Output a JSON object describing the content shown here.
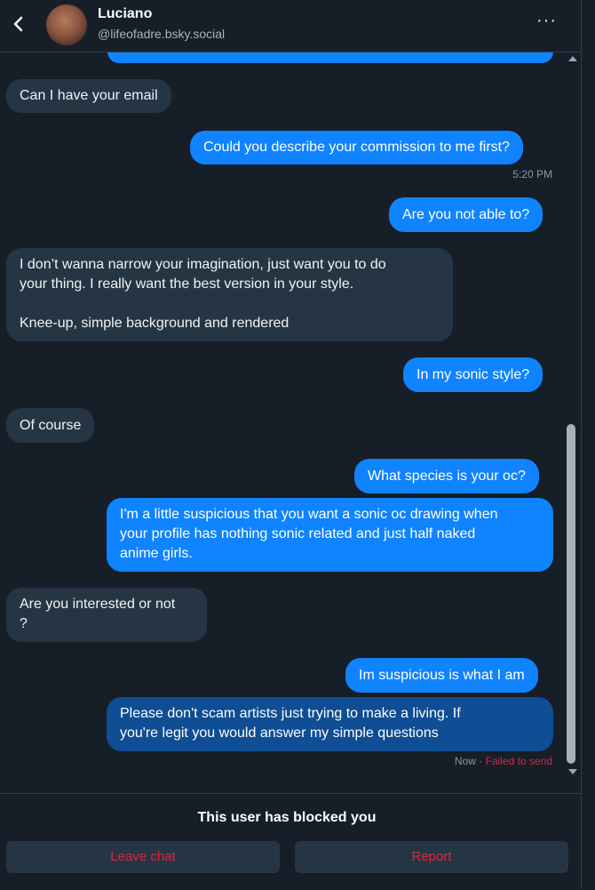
{
  "header": {
    "name": "Luciano",
    "handle": "@lifeofadre.bsky.social",
    "more_label": "···"
  },
  "messages": [
    {
      "sender": "them",
      "text": "Can I have your email"
    },
    {
      "sender": "me",
      "text": "Could you describe your commission to me first?",
      "time": "5:20 PM"
    },
    {
      "sender": "me",
      "text": "Are you not able to?"
    },
    {
      "sender": "them",
      "text": "I don’t wanna narrow your imagination, just want you to do\nyour thing. I really want the best version in your style.\n\nKnee-up, simple background and rendered"
    },
    {
      "sender": "me",
      "text": "In my sonic style?"
    },
    {
      "sender": "them",
      "text": "Of course"
    },
    {
      "sender": "me",
      "text": "What species is your oc?"
    },
    {
      "sender": "me",
      "text": "I'm a little suspicious that you want a sonic oc drawing when\nyour profile has nothing sonic related and just half naked\nanime girls."
    },
    {
      "sender": "them",
      "text": "Are you interested or not\n?"
    },
    {
      "sender": "me",
      "text": "Im suspicious is what I am"
    },
    {
      "sender": "me",
      "text": "Please don't scam artists just trying to make a living. If\nyou're legit you would answer my simple questions",
      "time": "Now",
      "status": "Failed to send"
    }
  ],
  "footer": {
    "blocked_text": "This user has blocked you",
    "leave_label": "Leave chat",
    "report_label": "Report"
  },
  "colors": {
    "background": "#161e27",
    "my_bubble": "#1083fe",
    "their_bubble": "#263544",
    "failed": "#e0243e"
  }
}
